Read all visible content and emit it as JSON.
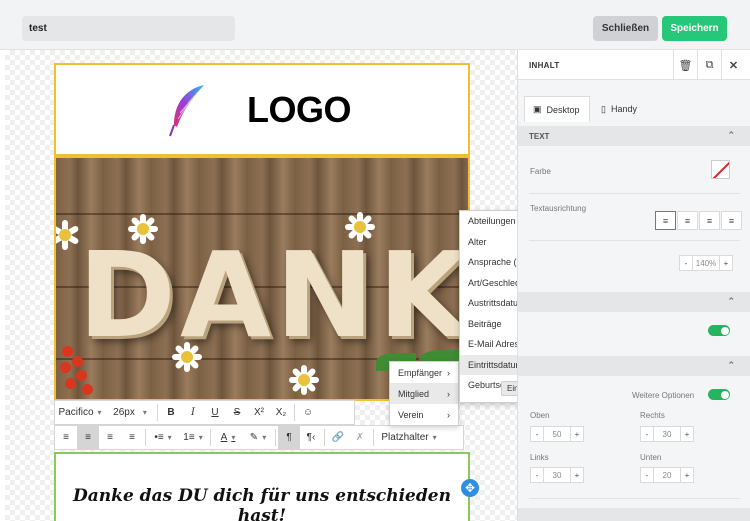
{
  "header": {
    "name_value": "test",
    "close_label": "Schließen",
    "save_label": "Speichern"
  },
  "colors": {
    "accent": "#27c77a",
    "selection_border": "#f0c030",
    "text_block_border": "#8dc85a",
    "handle": "#2f8ee0"
  },
  "canvas": {
    "logo_text": "LOGO",
    "image_text": "DANKE",
    "text_block_content": "Danke das DU dich für uns entschieden hast!"
  },
  "editor_toolbar": {
    "font_family": "Pacifico",
    "font_size": "26px",
    "placeholder_label": "Platzhalter",
    "icons": [
      "bold-icon",
      "italic-icon",
      "underline-icon",
      "strikethrough-icon",
      "superscript-icon",
      "subscript-icon",
      "emoji-icon",
      "align-left-icon",
      "align-center-icon",
      "align-right-icon",
      "justify-icon",
      "bullet-list-icon",
      "numbered-list-icon",
      "font-color-icon",
      "highlight-icon",
      "ltr-icon",
      "rtl-icon",
      "link-icon",
      "unlink-icon"
    ]
  },
  "placeholder_menu": {
    "items": [
      {
        "label": "Empfänger"
      },
      {
        "label": "Mitglied"
      },
      {
        "label": "Verein"
      }
    ]
  },
  "field_menu": {
    "items": [
      "Abteilungen",
      "Alter",
      "Ansprache (Grußformel + Name)",
      "Art/Geschlecht",
      "Austrittsdatum",
      "Beiträge",
      "E-Mail Adresse",
      "Eintrittsdatum",
      "Geburtsdatum"
    ],
    "hover_tooltip": "Eintrittsdatum"
  },
  "panel": {
    "title": "INHALT",
    "device_tabs": {
      "desktop": "Desktop",
      "mobile": "Handy"
    },
    "text_section": "TEXT",
    "color_label": "Farbe",
    "alignment_label": "Textausrichtung",
    "line_height_value": "140%",
    "more_options_label": "Weitere Optionen",
    "padding": {
      "top_label": "Oben",
      "top_value": "50",
      "right_label": "Rechts",
      "right_value": "30",
      "left_label": "Links",
      "left_value": "30",
      "bottom_label": "Unten",
      "bottom_value": "20"
    }
  }
}
